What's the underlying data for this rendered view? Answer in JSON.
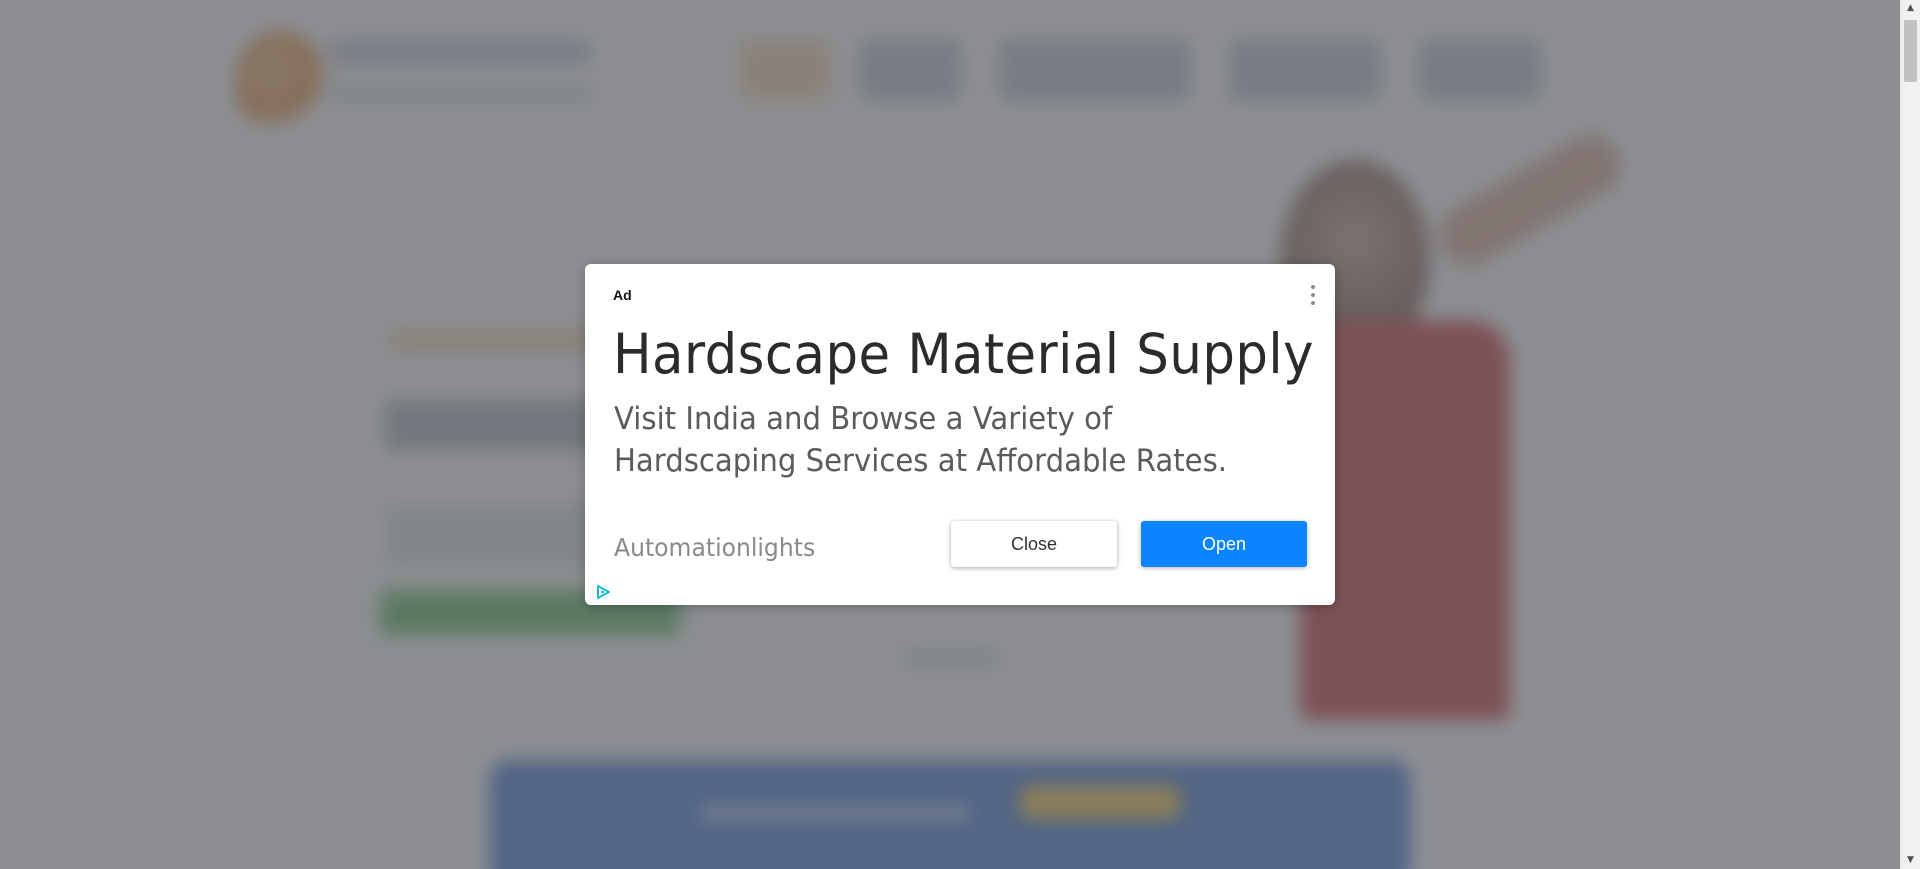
{
  "ad": {
    "label": "Ad",
    "headline": "Hardscape Material Supply",
    "description": "Visit India and Browse a Variety of Hardscaping Services at Affordable Rates.",
    "advertiser": "Automationlights",
    "close_label": "Close",
    "open_label": "Open"
  },
  "icons": {
    "menu": "vertical-dots-icon",
    "adchoices": "adchoices-triangle-icon",
    "scroll_up": "up-arrow-icon",
    "scroll_down": "down-arrow-icon"
  },
  "colors": {
    "open_button": "#0a84ff",
    "overlay": "rgba(95,98,104,0.72)",
    "adchoices": "#00aecd"
  }
}
